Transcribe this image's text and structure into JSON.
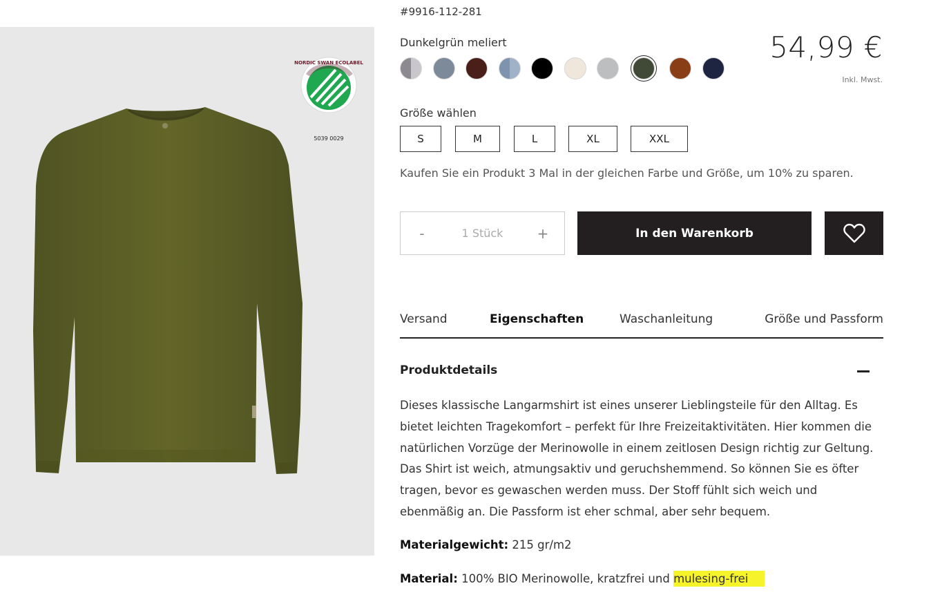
{
  "product": {
    "sku": "#9916-112-281",
    "color_name": "Dunkelgrün meliert",
    "price": "54,99 €",
    "price_note": "Inkl. Mwst.",
    "ecolabel": {
      "name": "NORDIC SWAN ECOLABEL",
      "number": "5039 0029"
    }
  },
  "swatches": [
    {
      "name": "grau-melange",
      "color": "#8c8a90",
      "color2": "#c9c7cc"
    },
    {
      "name": "blaugrau",
      "color": "#7d8a99"
    },
    {
      "name": "schokobraun",
      "color": "#4a1f1a"
    },
    {
      "name": "rauchblau",
      "color": "#7d93ae",
      "color2": "#a0b2c8"
    },
    {
      "name": "schwarz",
      "color": "#000000"
    },
    {
      "name": "natur",
      "color": "#efe6dc"
    },
    {
      "name": "hellgrau",
      "color": "#bdbebf"
    },
    {
      "name": "dunkelgruen-meliert",
      "color": "#404a36",
      "selected": true
    },
    {
      "name": "rost",
      "color": "#8a3e16"
    },
    {
      "name": "navy",
      "color": "#1d2540"
    }
  ],
  "sizes": {
    "label": "Größe wählen",
    "options": [
      "S",
      "M",
      "L",
      "XL",
      "XXL"
    ]
  },
  "promo_text": "Kaufen Sie ein Produkt 3 Mal in der gleichen Farbe und Größe, um 10% zu sparen.",
  "quantity": {
    "minus": "-",
    "value": "1 Stück",
    "plus": "+"
  },
  "cart_button": "In den Warenkorb",
  "tabs": [
    "Versand",
    "Eigenschaften",
    "Waschanleitung",
    "Größe und Passform"
  ],
  "active_tab": "Eigenschaften",
  "details": {
    "title": "Produktdetails",
    "description": "Dieses klassische Langarmshirt ist eines unserer Lieblingsteile für den Alltag. Es bietet leichten Tragekomfort – perfekt für Ihre Freizeitaktivitäten. Hier kommen die natürlichen Vorzüge der Merinowolle in einem zeitlosen Design richtig zur Geltung. Das Shirt ist weich, atmungsaktiv und geruchshemmend. So können Sie es öfter tragen, bevor es gewaschen werden muss. Der Stoff fühlt sich weich und ebenmäßig an. Die Passform ist eher schmal, aber sehr bequem.",
    "weight_label": "Materialgewicht:",
    "weight_value": "215 gr/m2",
    "material_label": "Material:",
    "material_value": "100% BIO Merinowolle, kratzfrei und",
    "material_highlight": "mulesing-frei"
  },
  "colors": {
    "highlight": "#f7f32a",
    "dark_button": "#231f20",
    "shirt": "#5c5f2a",
    "ecolabel_green": "#1fa84f"
  }
}
